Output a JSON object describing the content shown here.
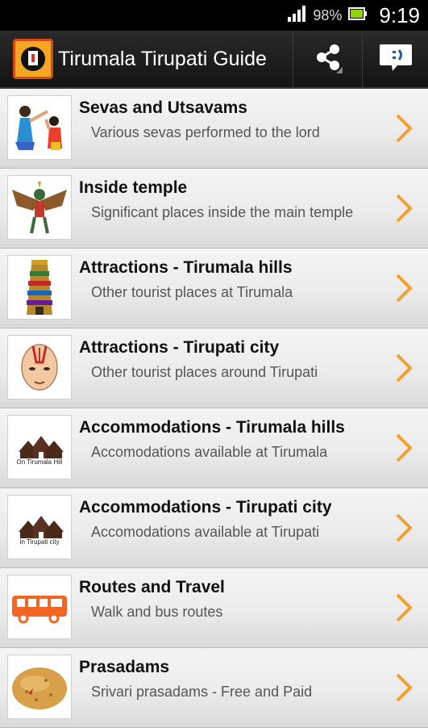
{
  "status_bar": {
    "battery_percent": "98%",
    "time": "9:19"
  },
  "action_bar": {
    "title": "Tirumala Tirupati Guide",
    "actions": [
      {
        "icon": "share-icon"
      },
      {
        "icon": "feedback-icon"
      }
    ]
  },
  "colors": {
    "accent": "#f0a030",
    "action_bar": "#1e1e1e",
    "row_top": "#f4f4f4",
    "row_bottom": "#d9d9d9"
  },
  "items": [
    {
      "title": "Sevas and Utsavams",
      "subtitle": "Various sevas performed to the lord",
      "icon": "worship-illustration"
    },
    {
      "title": "Inside temple",
      "subtitle": "Significant places inside the main temple",
      "icon": "garuda-illustration"
    },
    {
      "title": "Attractions - Tirumala hills",
      "subtitle": "Other tourist places at Tirumala",
      "icon": "temple-gopuram-illustration"
    },
    {
      "title": "Attractions - Tirupati city",
      "subtitle": "Other tourist places around Tirupati",
      "icon": "priest-face-illustration"
    },
    {
      "title": "Accommodations - Tirumala hills",
      "subtitle": "Accomodations available at Tirumala",
      "icon": "houses-icon",
      "caption": "On Tirumala Hill"
    },
    {
      "title": "Accommodations - Tirupati city",
      "subtitle": "Accomodations available at Tirupati",
      "icon": "houses-icon",
      "caption": "In Tirupati city"
    },
    {
      "title": "Routes and Travel",
      "subtitle": "Walk and bus routes",
      "icon": "bus-icon"
    },
    {
      "title": "Prasadams",
      "subtitle": "Srivari prasadams - Free and Paid",
      "icon": "laddu-illustration"
    }
  ]
}
